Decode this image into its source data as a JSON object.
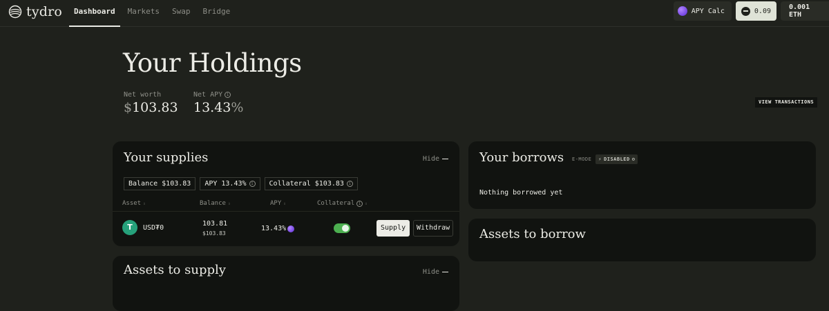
{
  "brand": {
    "name": "tydro"
  },
  "nav": {
    "links": [
      "Dashboard",
      "Markets",
      "Swap",
      "Bridge"
    ],
    "apy_calc": "APY Calc",
    "points": "0.09",
    "wallet": "0.001 ETH"
  },
  "holdings": {
    "title": "Your Holdings",
    "net_worth_label": "Net worth",
    "net_worth_currency": "$",
    "net_worth_value": "103.83",
    "net_apy_label": "Net APY",
    "net_apy_value": "13.43",
    "net_apy_unit": "%",
    "view_transactions": "VIEW TRANSACTIONS"
  },
  "supplies": {
    "title": "Your supplies",
    "hide": "Hide",
    "balance_chip": "Balance $103.83",
    "apy_chip": "APY 13.43%",
    "collateral_chip": "Collateral $103.83",
    "columns": {
      "asset": "Asset",
      "balance": "Balance",
      "apy": "APY",
      "collateral": "Collateral"
    },
    "row": {
      "asset_symbol": "USD₮0",
      "asset_icon_glyph": "T",
      "balance": "103.81",
      "balance_usd": "$103.83",
      "apy": "13.43%",
      "collateral_enabled": true,
      "supply_label": "Supply",
      "withdraw_label": "Withdraw"
    }
  },
  "borrows": {
    "title": "Your borrows",
    "emode_label": "E-MODE",
    "emode_status": "DISABLED",
    "empty": "Nothing borrowed yet"
  },
  "assets_to_borrow": {
    "title": "Assets to borrow"
  },
  "assets_to_supply": {
    "title": "Assets to supply",
    "hide": "Hide"
  },
  "colors": {
    "accent_green": "#4caf50",
    "tether_green": "#26a17b",
    "apy_purple": "#7c4dff"
  }
}
